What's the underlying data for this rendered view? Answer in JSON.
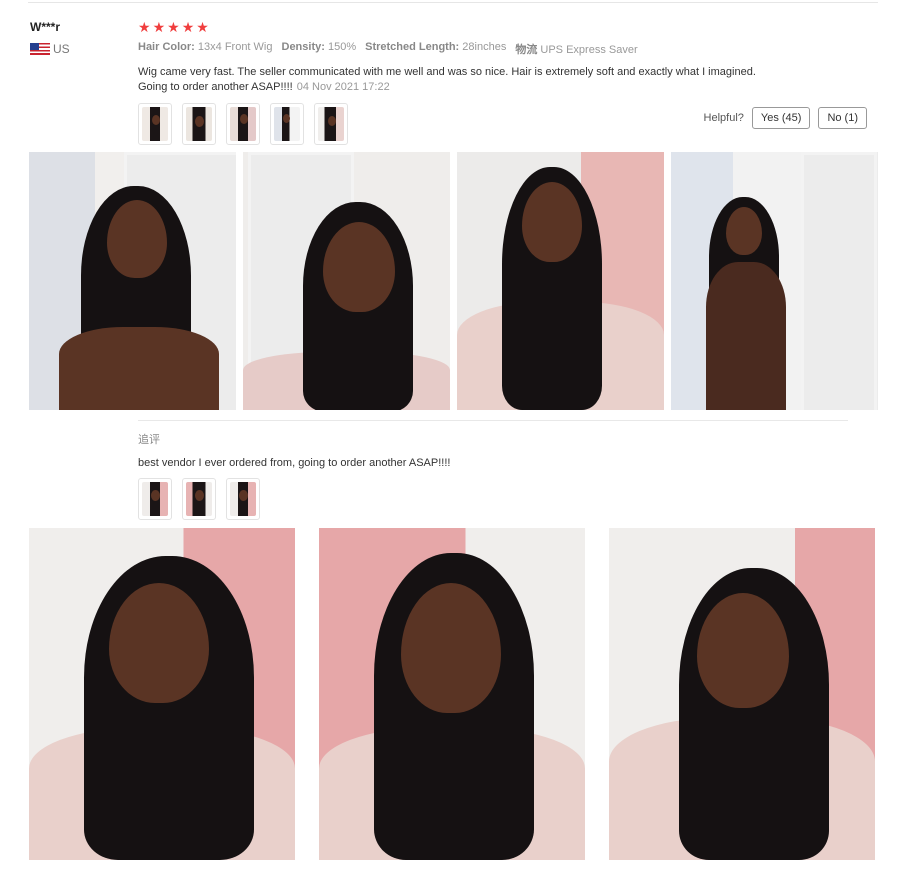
{
  "user": {
    "name": "W***r",
    "country": "US"
  },
  "review": {
    "stars": 5,
    "attributes": [
      {
        "label": "Hair Color:",
        "value": "13x4 Front Wig"
      },
      {
        "label": "Density:",
        "value": "150%"
      },
      {
        "label": "Stretched Length:",
        "value": "28inches"
      },
      {
        "label": "物流",
        "value": "UPS Express Saver"
      }
    ],
    "comment": "Wig came very fast. The seller communicated with me well and was so nice. Hair is extremely soft and exactly what I imagined. Going to order another ASAP!!!!",
    "date": "04 Nov 2021 17:22",
    "thumbnail_count": 5
  },
  "helpful": {
    "label": "Helpful?",
    "yes": "Yes (45)",
    "no": "No (1)"
  },
  "followup": {
    "title": "追评",
    "text": "best vendor I ever ordered from, going to order another ASAP!!!!",
    "thumbnail_count": 3
  },
  "colors": {
    "star": "#f03e3e",
    "wall_pink": "#e6a7a8",
    "wall_white": "#f0eeec",
    "skin": "#5a3424",
    "hair": "#151112"
  }
}
